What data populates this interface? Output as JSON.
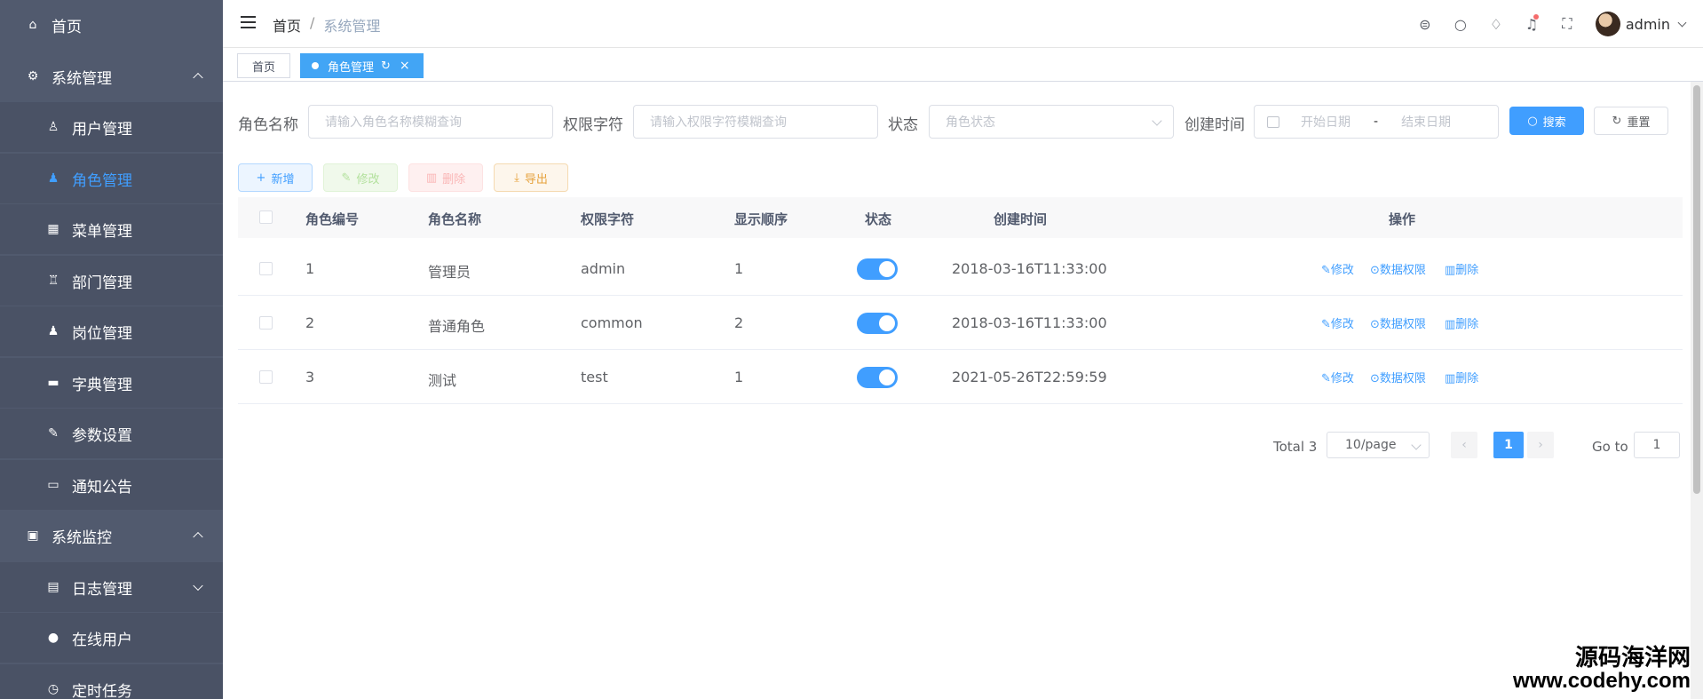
{
  "sidebar": {
    "items": [
      {
        "label": "首页",
        "icon": "home-icon"
      },
      {
        "label": "系统管理",
        "icon": "gear-icon"
      },
      {
        "label": "用户管理",
        "icon": "user-icon"
      },
      {
        "label": "角色管理",
        "icon": "user-filled-icon"
      },
      {
        "label": "菜单管理",
        "icon": "grid-icon"
      },
      {
        "label": "部门管理",
        "icon": "tree-icon"
      },
      {
        "label": "岗位管理",
        "icon": "post-icon"
      },
      {
        "label": "字典管理",
        "icon": "dict-icon"
      },
      {
        "label": "参数设置",
        "icon": "edit-icon"
      },
      {
        "label": "通知公告",
        "icon": "message-icon"
      },
      {
        "label": "系统监控",
        "icon": "monitor-icon"
      },
      {
        "label": "日志管理",
        "icon": "log-icon"
      },
      {
        "label": "在线用户",
        "icon": "online-icon"
      },
      {
        "label": "定时任务",
        "icon": "clock-icon"
      }
    ]
  },
  "navbar": {
    "breadcrumb": {
      "home": "首页",
      "sep": "/",
      "current": "系统管理"
    },
    "username": "admin"
  },
  "tags": {
    "home": "首页",
    "active": "角色管理",
    "refresh": "↻",
    "close": "×"
  },
  "search": {
    "role_name_label": "角色名称",
    "role_name_placeholder": "请输入角色名称模糊查询",
    "perm_label": "权限字符",
    "perm_placeholder": "请输入权限字符模糊查询",
    "status_label": "状态",
    "status_placeholder": "角色状态",
    "created_label": "创建时间",
    "start_placeholder": "开始日期",
    "range_sep": "-",
    "end_placeholder": "结束日期",
    "search_btn": "搜索",
    "reset_btn": "重置"
  },
  "toolbar": {
    "add": "新增",
    "edit": "修改",
    "delete": "删除",
    "export": "导出"
  },
  "table": {
    "headers": [
      "角色编号",
      "角色名称",
      "权限字符",
      "显示顺序",
      "状态",
      "创建时间",
      "操作"
    ],
    "rows": [
      {
        "id": "1",
        "name": "管理员",
        "key": "admin",
        "order": "1",
        "enabled": true,
        "created": "2018-03-16T11:33:00"
      },
      {
        "id": "2",
        "name": "普通角色",
        "key": "common",
        "order": "2",
        "enabled": true,
        "created": "2018-03-16T11:33:00"
      },
      {
        "id": "3",
        "name": "测试",
        "key": "test",
        "order": "1",
        "enabled": true,
        "created": "2021-05-26T22:59:59"
      }
    ],
    "actions": {
      "edit": "修改",
      "data_scope": "数据权限",
      "delete": "删除"
    }
  },
  "pagination": {
    "total": "Total 3",
    "page_size": "10/page",
    "prev": "‹",
    "next": "›",
    "current": "1",
    "goto_label": "Go to",
    "goto_value": "1"
  },
  "watermark": {
    "line1": "源码海洋网",
    "line2": "www.codehy.com"
  },
  "colors": {
    "primary": "#409eff",
    "sidebar": "#515a6e",
    "success": "#67c23a",
    "danger": "#f56c6c",
    "warning": "#e6a23c"
  }
}
